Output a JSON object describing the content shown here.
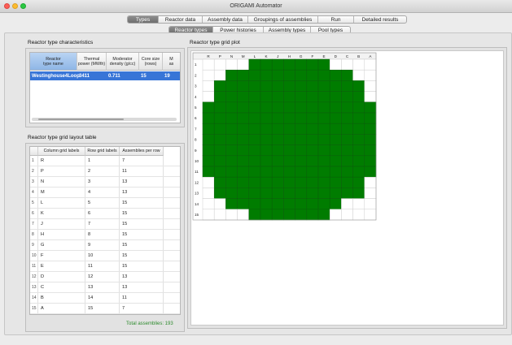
{
  "window": {
    "title": "ORIGAMI Automator"
  },
  "main_tabs": [
    {
      "label": "Types",
      "active": true
    },
    {
      "label": "Reactor data",
      "active": false
    },
    {
      "label": "Assembly data",
      "active": false
    },
    {
      "label": "Groupings of assemblies",
      "active": false
    },
    {
      "label": "Run",
      "active": false
    },
    {
      "label": "Detailed results",
      "active": false
    }
  ],
  "sub_tabs": [
    {
      "label": "Reactor types",
      "active": true
    },
    {
      "label": "Power histories",
      "active": false
    },
    {
      "label": "Assembly types",
      "active": false
    },
    {
      "label": "Pool types",
      "active": false
    }
  ],
  "characteristics": {
    "title": "Reactor type characteristics",
    "headers": [
      {
        "line1": "Reactor",
        "line2": "type name"
      },
      {
        "line1": "Thermal",
        "line2": "power (MWth)"
      },
      {
        "line1": "Moderator",
        "line2": "density (g/cc)"
      },
      {
        "line1": "Core size",
        "line2": "(rows)"
      },
      {
        "line1": "M",
        "line2": "as"
      }
    ],
    "row": [
      "Westinghouse4Loop",
      "3411",
      "0.711",
      "15",
      "19"
    ]
  },
  "layout": {
    "title": "Reactor type grid layout table",
    "headers": [
      "Column grid labels",
      "Row grid labels",
      "Assemblies per row"
    ],
    "rows": [
      [
        "1",
        "R",
        "1",
        "7"
      ],
      [
        "2",
        "P",
        "2",
        "11"
      ],
      [
        "3",
        "N",
        "3",
        "13"
      ],
      [
        "4",
        "M",
        "4",
        "13"
      ],
      [
        "5",
        "L",
        "5",
        "15"
      ],
      [
        "6",
        "K",
        "6",
        "15"
      ],
      [
        "7",
        "J",
        "7",
        "15"
      ],
      [
        "8",
        "H",
        "8",
        "15"
      ],
      [
        "9",
        "G",
        "9",
        "15"
      ],
      [
        "10",
        "F",
        "10",
        "15"
      ],
      [
        "11",
        "E",
        "11",
        "15"
      ],
      [
        "12",
        "D",
        "12",
        "13"
      ],
      [
        "13",
        "C",
        "13",
        "13"
      ],
      [
        "14",
        "B",
        "14",
        "11"
      ],
      [
        "15",
        "A",
        "15",
        "7"
      ]
    ],
    "total": "Total assemblies: 193"
  },
  "plot": {
    "title": "Reactor type grid plot",
    "column_labels": [
      "R",
      "P",
      "N",
      "M",
      "L",
      "K",
      "J",
      "H",
      "G",
      "F",
      "E",
      "D",
      "C",
      "B",
      "A"
    ],
    "row_labels": [
      "1",
      "2",
      "3",
      "4",
      "5",
      "6",
      "7",
      "8",
      "9",
      "10",
      "11",
      "12",
      "13",
      "14",
      "15"
    ],
    "filled_color": "#007c00",
    "rows": [
      [
        4,
        10
      ],
      [
        2,
        12
      ],
      [
        1,
        13
      ],
      [
        1,
        13
      ],
      [
        0,
        14
      ],
      [
        0,
        14
      ],
      [
        0,
        14
      ],
      [
        0,
        14
      ],
      [
        0,
        14
      ],
      [
        0,
        14
      ],
      [
        0,
        14
      ],
      [
        1,
        13
      ],
      [
        1,
        13
      ],
      [
        2,
        11
      ],
      [
        4,
        10
      ]
    ]
  }
}
